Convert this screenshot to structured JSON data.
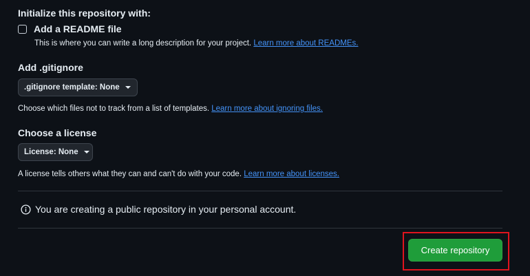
{
  "init": {
    "heading": "Initialize this repository with:",
    "readme_label": "Add a README file",
    "readme_checked": false,
    "readme_help": "This is where you can write a long description for your project.",
    "readme_link": "Learn more about READMEs."
  },
  "gitignore": {
    "heading": "Add .gitignore",
    "dropdown_label": ".gitignore template: None",
    "help": "Choose which files not to track from a list of templates.",
    "link": "Learn more about ignoring files."
  },
  "license": {
    "heading": "Choose a license",
    "dropdown_label": "License: None",
    "help": "A license tells others what they can and can't do with your code.",
    "link": "Learn more about licenses."
  },
  "notice": {
    "icon": "info-icon",
    "text": "You are creating a public repository in your personal account."
  },
  "actions": {
    "create_label": "Create repository"
  },
  "colors": {
    "background": "#0d1117",
    "link": "#4493f8",
    "primary_button": "#1f9d3a",
    "highlight": "#e0141e"
  }
}
